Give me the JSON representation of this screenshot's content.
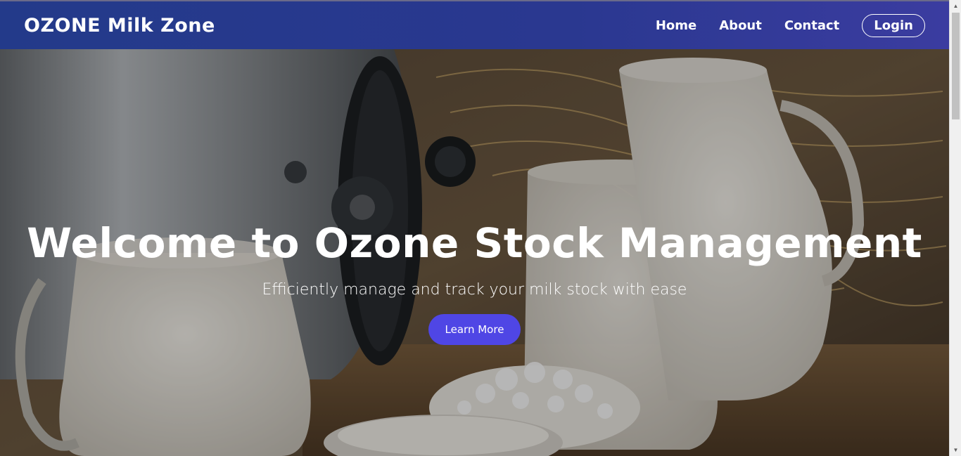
{
  "brand": {
    "name": "OZONE Milk Zone"
  },
  "nav": {
    "home": "Home",
    "about": "About",
    "contact": "Contact",
    "login": "Login"
  },
  "hero": {
    "title": "Welcome to Ozone Stock Management",
    "subtitle": "Efficiently manage and track your milk stock with ease",
    "cta": "Learn More"
  },
  "colors": {
    "navbar": "#2a3890",
    "cta": "#4f46e5"
  },
  "icons": {
    "scroll_up": "triangle-up",
    "scroll_down": "triangle-down"
  }
}
